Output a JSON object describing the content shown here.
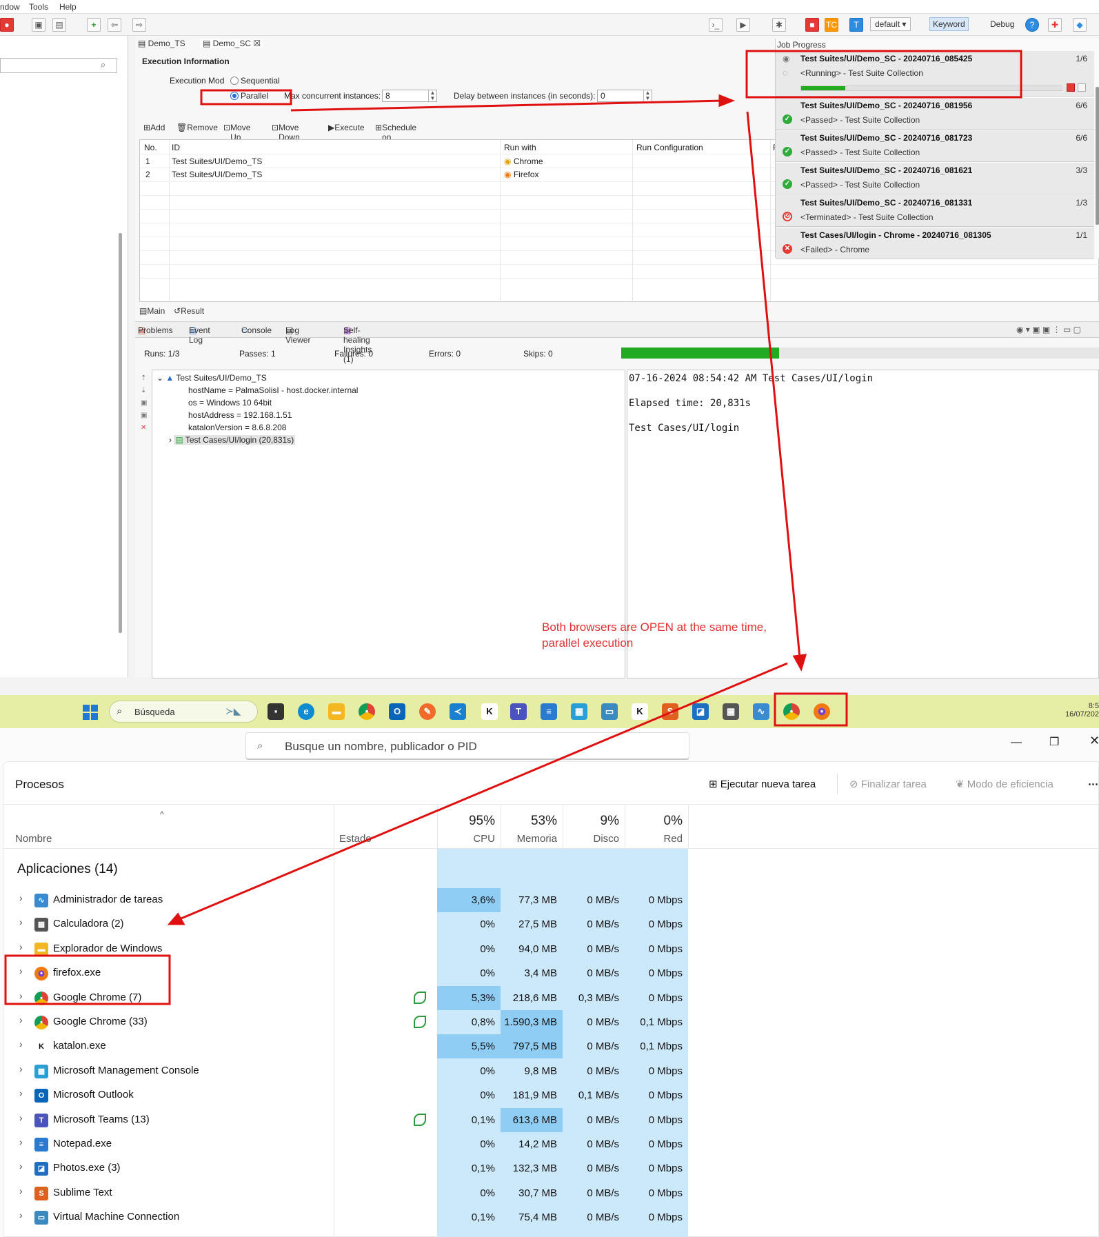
{
  "menubar": {
    "items": [
      "ndow",
      "Tools",
      "Help"
    ]
  },
  "toolbar": {
    "profile": "default",
    "keyword": "Keyword",
    "debug": "Debug"
  },
  "editor": {
    "tabs": [
      "Demo_TS",
      "Demo_SC"
    ],
    "section_title": "Execution Information",
    "execution_mode_label": "Execution Mod",
    "sequential": "Sequential",
    "parallel": "Parallel",
    "max_concurrent_label": "Max concurrent instances:",
    "max_concurrent_value": "8",
    "delay_label": "Delay between instances (in seconds):",
    "delay_value": "0",
    "actions": [
      "Add",
      "Remove",
      "Move Up",
      "Move Down",
      "Execute",
      "Schedule on Katalon TestOps"
    ],
    "grid": {
      "headers": [
        "No.",
        "ID",
        "Run with",
        "Run Configuration",
        "P"
      ],
      "rows": [
        {
          "no": "1",
          "id": "Test Suites/UI/Demo_TS",
          "run_with": "Chrome"
        },
        {
          "no": "2",
          "id": "Test Suites/UI/Demo_TS",
          "run_with": "Firefox"
        }
      ]
    },
    "bottom_tabs": [
      "Main",
      "Result"
    ]
  },
  "job_progress": {
    "title": "Job Progress",
    "jobs": [
      {
        "name": "Test Suites/UI/Demo_SC - 20240716_085425",
        "count": "1/6",
        "status": "<Running> - Test Suite Collection",
        "state": "running",
        "progress": 0.17
      },
      {
        "name": "Test Suites/UI/Demo_SC - 20240716_081956",
        "count": "6/6",
        "status": "<Passed> - Test Suite Collection",
        "state": "passed"
      },
      {
        "name": "Test Suites/UI/Demo_SC - 20240716_081723",
        "count": "6/6",
        "status": "<Passed> - Test Suite Collection",
        "state": "passed"
      },
      {
        "name": "Test Suites/UI/Demo_SC - 20240716_081621",
        "count": "3/3",
        "status": "<Passed> - Test Suite Collection",
        "state": "passed"
      },
      {
        "name": "Test Suites/UI/Demo_SC - 20240716_081331",
        "count": "1/3",
        "status": "<Terminated> - Test Suite Collection",
        "state": "terminated"
      },
      {
        "name": "Test Cases/UI/login - Chrome - 20240716_081305",
        "count": "1/1",
        "status": "<Failed> - Chrome",
        "state": "failed"
      }
    ]
  },
  "console_tabs": [
    "Problems",
    "Event Log",
    "Console",
    "Log Viewer",
    "Self-healing Insights (1)"
  ],
  "stats": {
    "runs": "Runs: 1/3",
    "passes": "Passes: 1",
    "failures": "Failures: 0",
    "errors": "Errors: 0",
    "skips": "Skips: 0",
    "progress": 0.33
  },
  "tree": {
    "root": "Test Suites/UI/Demo_TS",
    "props": [
      "hostName = PalmaSolisI - host.docker.internal",
      "os = Windows 10 64bit",
      "hostAddress = 192.168.1.51",
      "katalonVersion = 8.6.8.208"
    ],
    "child": "Test Cases/UI/login (20,831s)"
  },
  "log": {
    "line1": "07-16-2024 08:54:42 AM Test Cases/UI/login",
    "line2": "Elapsed time: 20,831s",
    "line3": "Test Cases/UI/login"
  },
  "annotation": {
    "line1": "Both browsers are OPEN at the same time,",
    "line2": "parallel execution"
  },
  "taskbar": {
    "search_placeholder": "Búsqueda",
    "time": "8:5",
    "date": "16/07/202"
  },
  "task_manager": {
    "search_placeholder": "Busque un nombre, publicador o PID",
    "title": "Procesos",
    "buttons": {
      "run_new": "Ejecutar nueva tarea",
      "end_task": "Finalizar tarea",
      "efficiency": "Modo de eficiencia"
    },
    "columns": {
      "name": "Nombre",
      "status": "Estado",
      "cpu_pct": "95%",
      "cpu": "CPU",
      "mem_pct": "53%",
      "mem": "Memoria",
      "disk_pct": "9%",
      "disk": "Disco",
      "net_pct": "0%",
      "net": "Red"
    },
    "group": "Aplicaciones (14)",
    "processes": [
      {
        "name": "Administrador de tareas",
        "cpu": "3,6%",
        "mem": "77,3 MB",
        "disk": "0 MB/s",
        "net": "0 Mbps",
        "eco": false,
        "icon": "task-manager-icon",
        "cpu_hot": true,
        "mem_hot": false
      },
      {
        "name": "Calculadora (2)",
        "cpu": "0%",
        "mem": "27,5 MB",
        "disk": "0 MB/s",
        "net": "0 Mbps",
        "eco": false,
        "icon": "calculator-icon",
        "cpu_hot": false,
        "mem_hot": false
      },
      {
        "name": "Explorador de Windows",
        "cpu": "0%",
        "mem": "94,0 MB",
        "disk": "0 MB/s",
        "net": "0 Mbps",
        "eco": false,
        "icon": "folder-icon",
        "cpu_hot": false,
        "mem_hot": false
      },
      {
        "name": "firefox.exe",
        "cpu": "0%",
        "mem": "3,4 MB",
        "disk": "0 MB/s",
        "net": "0 Mbps",
        "eco": false,
        "icon": "firefox-icon",
        "cpu_hot": false,
        "mem_hot": false
      },
      {
        "name": "Google Chrome (7)",
        "cpu": "5,3%",
        "mem": "218,6 MB",
        "disk": "0,3 MB/s",
        "net": "0 Mbps",
        "eco": true,
        "icon": "chrome-icon",
        "cpu_hot": true,
        "mem_hot": false
      },
      {
        "name": "Google Chrome (33)",
        "cpu": "0,8%",
        "mem": "1.590,3 MB",
        "disk": "0 MB/s",
        "net": "0,1 Mbps",
        "eco": true,
        "icon": "chrome-icon",
        "cpu_hot": false,
        "mem_hot": true
      },
      {
        "name": "katalon.exe",
        "cpu": "5,5%",
        "mem": "797,5 MB",
        "disk": "0 MB/s",
        "net": "0,1 Mbps",
        "eco": false,
        "icon": "katalon-icon",
        "cpu_hot": true,
        "mem_hot": true
      },
      {
        "name": "Microsoft Management Console",
        "cpu": "0%",
        "mem": "9,8 MB",
        "disk": "0 MB/s",
        "net": "0 Mbps",
        "eco": false,
        "icon": "mmc-icon",
        "cpu_hot": false,
        "mem_hot": false
      },
      {
        "name": "Microsoft Outlook",
        "cpu": "0%",
        "mem": "181,9 MB",
        "disk": "0,1 MB/s",
        "net": "0 Mbps",
        "eco": false,
        "icon": "outlook-icon",
        "cpu_hot": false,
        "mem_hot": false
      },
      {
        "name": "Microsoft Teams (13)",
        "cpu": "0,1%",
        "mem": "613,6 MB",
        "disk": "0 MB/s",
        "net": "0 Mbps",
        "eco": true,
        "icon": "teams-icon",
        "cpu_hot": false,
        "mem_hot": true
      },
      {
        "name": "Notepad.exe",
        "cpu": "0%",
        "mem": "14,2 MB",
        "disk": "0 MB/s",
        "net": "0 Mbps",
        "eco": false,
        "icon": "notepad-icon",
        "cpu_hot": false,
        "mem_hot": false
      },
      {
        "name": "Photos.exe (3)",
        "cpu": "0,1%",
        "mem": "132,3 MB",
        "disk": "0 MB/s",
        "net": "0 Mbps",
        "eco": false,
        "icon": "photos-icon",
        "cpu_hot": false,
        "mem_hot": false
      },
      {
        "name": "Sublime Text",
        "cpu": "0%",
        "mem": "30,7 MB",
        "disk": "0 MB/s",
        "net": "0 Mbps",
        "eco": false,
        "icon": "sublime-icon",
        "cpu_hot": false,
        "mem_hot": false
      },
      {
        "name": "Virtual Machine Connection",
        "cpu": "0,1%",
        "mem": "75,4 MB",
        "disk": "0 MB/s",
        "net": "0 Mbps",
        "eco": false,
        "icon": "vm-icon",
        "cpu_hot": false,
        "mem_hot": false
      }
    ]
  },
  "colors": {
    "accent_red": "#e01010",
    "progress_green": "#22aa22",
    "heat_light": "#cce8fb",
    "heat_hot": "#8fcdf5"
  }
}
